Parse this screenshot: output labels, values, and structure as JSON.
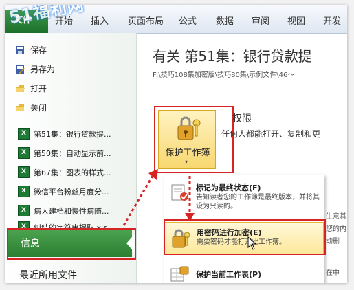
{
  "watermark": "51福利网",
  "ribbon": {
    "file_tab": "文件",
    "tabs": [
      "开始",
      "插入",
      "页面布局",
      "公式",
      "数据",
      "审阅",
      "视图",
      "开发"
    ]
  },
  "sidebar": {
    "commands": [
      {
        "label": "保存",
        "icon": "save-icon"
      },
      {
        "label": "另存为",
        "icon": "save-as-icon"
      },
      {
        "label": "打开",
        "icon": "open-folder-icon"
      },
      {
        "label": "关闭",
        "icon": "close-folder-icon"
      }
    ],
    "recent": [
      "第51集：银行贷款提...",
      "第50集：自动显示前...",
      "第67集：图表的样式...",
      "微信平台粉丝月度分...",
      "病人建档和慢性病随...",
      "纠结的字符串提取.xls..."
    ],
    "info_label": "信息",
    "recent_files_label": "最近所用文件"
  },
  "main": {
    "title": "有关 第51集：银行贷款提",
    "path": "F:\\技巧108集加密版\\技巧80集\\示例文件\\46～",
    "protect_button": "保护工作簿",
    "permissions_title": "权限",
    "permissions_desc": "任何人都能打开、复制和更",
    "right_fragments": [
      "生意其",
      "您的内",
      "动删",
      "在中"
    ]
  },
  "dropdown": {
    "items": [
      {
        "title": "标记为最终状态(F)",
        "desc": "告知读者您的工作簿是最终版本，并将其设为只读的。"
      },
      {
        "title": "用密码进行加密(E)",
        "desc": "需要密码才能打开此工作簿。"
      },
      {
        "title": "保护当前工作表(P)",
        "desc": ""
      }
    ]
  },
  "colors": {
    "accent_green": "#2b7f31",
    "highlight_red": "#d62424",
    "button_gold": "#f8d770"
  }
}
